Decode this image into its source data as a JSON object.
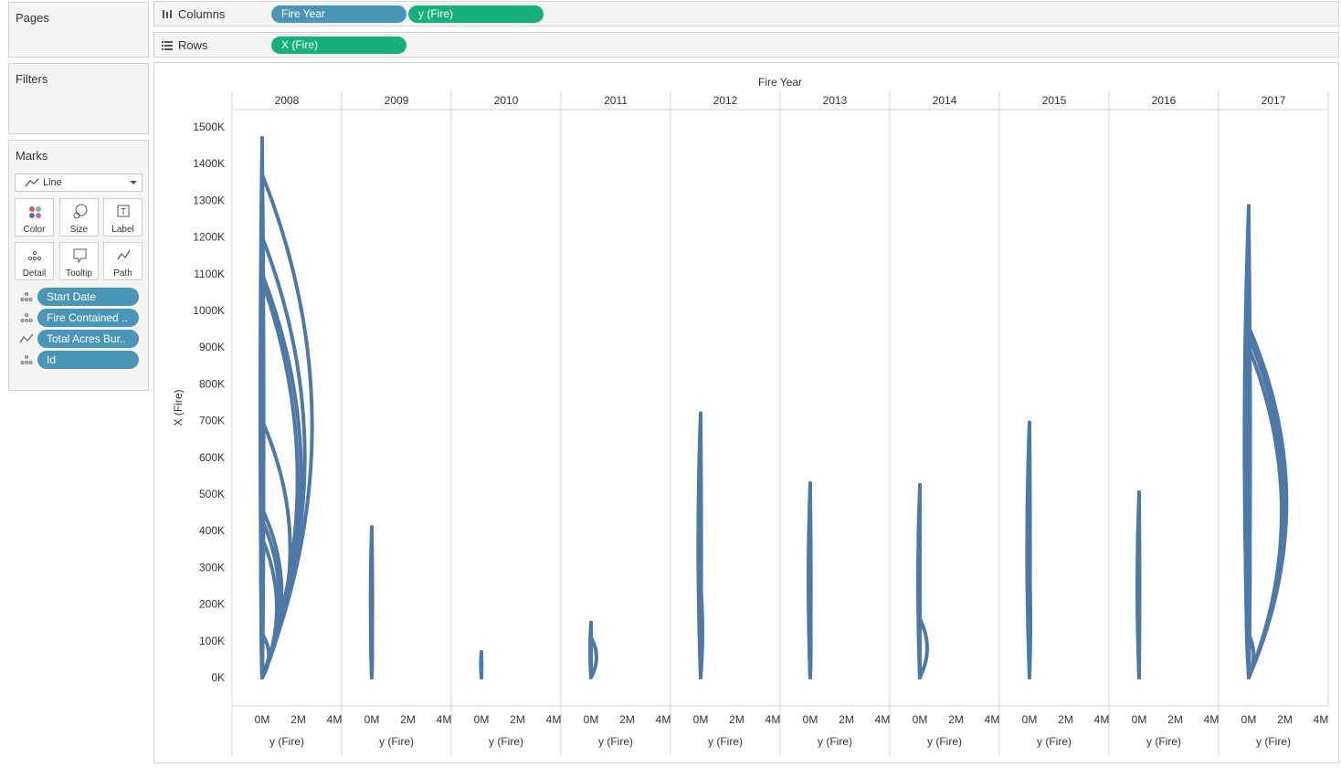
{
  "pages": {
    "title": "Pages"
  },
  "filters": {
    "title": "Filters"
  },
  "marks": {
    "title": "Marks",
    "mark_type": "Line",
    "buttons": [
      "Color",
      "Size",
      "Label",
      "Detail",
      "Tooltip",
      "Path"
    ],
    "pills": [
      {
        "label": "Start Date",
        "icon": "detail-icon"
      },
      {
        "label": "Fire Contained ..",
        "icon": "detail-icon"
      },
      {
        "label": "Total Acres Bur..",
        "icon": "path-icon"
      },
      {
        "label": "Id",
        "icon": "detail-icon"
      }
    ]
  },
  "columns": {
    "label": "Columns",
    "pills": [
      "Fire Year",
      "y (Fire)"
    ]
  },
  "rows": {
    "label": "Rows",
    "pills": [
      "X (Fire)"
    ]
  },
  "colors": {
    "mark": "#4e79a7",
    "pill_dimension": "#4a96b8",
    "pill_measure": "#16b07d"
  },
  "chart_data": {
    "type": "line",
    "header_title": "Fire Year",
    "panels": [
      "2008",
      "2009",
      "2010",
      "2011",
      "2012",
      "2013",
      "2014",
      "2015",
      "2016",
      "2017"
    ],
    "ylabel": "X (Fire)",
    "xlabel": "y (Fire)",
    "yticks": [
      "1500K",
      "1400K",
      "1300K",
      "1200K",
      "1100K",
      "1000K",
      "900K",
      "800K",
      "700K",
      "600K",
      "500K",
      "400K",
      "300K",
      "200K",
      "100K",
      "0K"
    ],
    "xticks": [
      "0M",
      "2M",
      "4M"
    ],
    "ylim": [
      0,
      1500000
    ],
    "xlim": [
      -0.5,
      4
    ],
    "fires": {
      "2008": [
        {
          "peak": 1470000,
          "bulge": -0.15
        },
        {
          "peak": 1430000,
          "bulge": 0.12
        },
        {
          "peak": 1400000,
          "bulge": -0.12
        },
        {
          "peak": 1370000,
          "bulge": 4.1
        },
        {
          "peak": 1200000,
          "bulge": 3.5
        },
        {
          "peak": 1100000,
          "bulge": 3.2
        },
        {
          "peak": 1080000,
          "bulge": 2.9
        },
        {
          "peak": 1000000,
          "bulge": -0.12
        },
        {
          "peak": 950000,
          "bulge": 0.1
        },
        {
          "peak": 830000,
          "bulge": 0.09
        },
        {
          "peak": 700000,
          "bulge": 2.3
        },
        {
          "peak": 600000,
          "bulge": -0.1
        },
        {
          "peak": 460000,
          "bulge": 1.6
        },
        {
          "peak": 430000,
          "bulge": 1.4
        },
        {
          "peak": 380000,
          "bulge": 1.2
        },
        {
          "peak": 300000,
          "bulge": -0.08
        },
        {
          "peak": 120000,
          "bulge": 0.55
        }
      ],
      "2009": [
        {
          "peak": 410000,
          "bulge": -0.1
        },
        {
          "peak": 390000,
          "bulge": 0.05
        },
        {
          "peak": 230000,
          "bulge": -0.08
        },
        {
          "peak": 150000,
          "bulge": 0.04
        }
      ],
      "2010": [
        {
          "peak": 70000,
          "bulge": -0.05
        },
        {
          "peak": 60000,
          "bulge": 0.03
        }
      ],
      "2011": [
        {
          "peak": 150000,
          "bulge": -0.08
        },
        {
          "peak": 110000,
          "bulge": 0.45
        }
      ],
      "2012": [
        {
          "peak": 720000,
          "bulge": -0.2
        },
        {
          "peak": 700000,
          "bulge": 0.05
        },
        {
          "peak": 400000,
          "bulge": -0.1
        },
        {
          "peak": 250000,
          "bulge": 0.15
        }
      ],
      "2013": [
        {
          "peak": 530000,
          "bulge": -0.15
        },
        {
          "peak": 500000,
          "bulge": 0.05
        },
        {
          "peak": 240000,
          "bulge": -0.08
        },
        {
          "peak": 180000,
          "bulge": 0.05
        }
      ],
      "2014": [
        {
          "peak": 525000,
          "bulge": -0.15
        },
        {
          "peak": 300000,
          "bulge": -0.1
        },
        {
          "peak": 160000,
          "bulge": 0.6
        }
      ],
      "2015": [
        {
          "peak": 695000,
          "bulge": -0.2
        },
        {
          "peak": 680000,
          "bulge": 0.05
        },
        {
          "peak": 450000,
          "bulge": -0.1
        },
        {
          "peak": 300000,
          "bulge": 0.08
        }
      ],
      "2016": [
        {
          "peak": 505000,
          "bulge": -0.15
        },
        {
          "peak": 480000,
          "bulge": 0.04
        },
        {
          "peak": 300000,
          "bulge": -0.08
        }
      ],
      "2017": [
        {
          "peak": 1285000,
          "bulge": -0.35
        },
        {
          "peak": 1250000,
          "bulge": 0.12
        },
        {
          "peak": 1000000,
          "bulge": -0.3
        },
        {
          "peak": 955000,
          "bulge": 3.1
        },
        {
          "peak": 930000,
          "bulge": 2.9
        },
        {
          "peak": 900000,
          "bulge": 2.7
        },
        {
          "peak": 700000,
          "bulge": -0.25
        },
        {
          "peak": 600000,
          "bulge": 0.1
        },
        {
          "peak": 400000,
          "bulge": -0.2
        },
        {
          "peak": 120000,
          "bulge": 0.4
        }
      ]
    }
  }
}
